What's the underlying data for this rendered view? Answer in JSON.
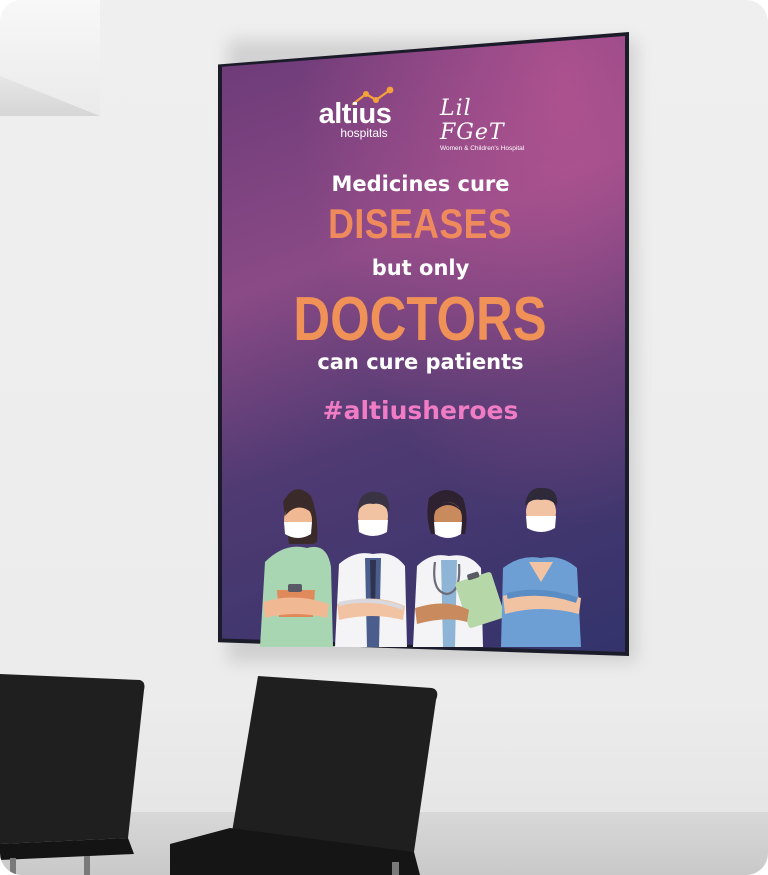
{
  "poster": {
    "logo_altius": "altius",
    "logo_altius_sub": "hospitals",
    "logo_lilfeet": "Lil FGeT",
    "logo_lilfeet_sub": "Women & Children's Hospital",
    "line1": "Medicines cure",
    "line2": "DISEASES",
    "line3": "but only",
    "line4": "DOCTORS",
    "line5": "can cure patients",
    "hashtag": "#altiusheroes"
  },
  "colors": {
    "poster_top": "#8a4a86",
    "poster_bottom": "#33336b",
    "accent_orange": "#f09157",
    "hashtag_pink": "#f07cc5",
    "logo_orange": "#f5a23a"
  },
  "illustration": {
    "figures": [
      "nurse-with-clipboard",
      "doctor-with-tie",
      "doctor-with-stethoscope",
      "nurse-in-scrubs"
    ]
  }
}
